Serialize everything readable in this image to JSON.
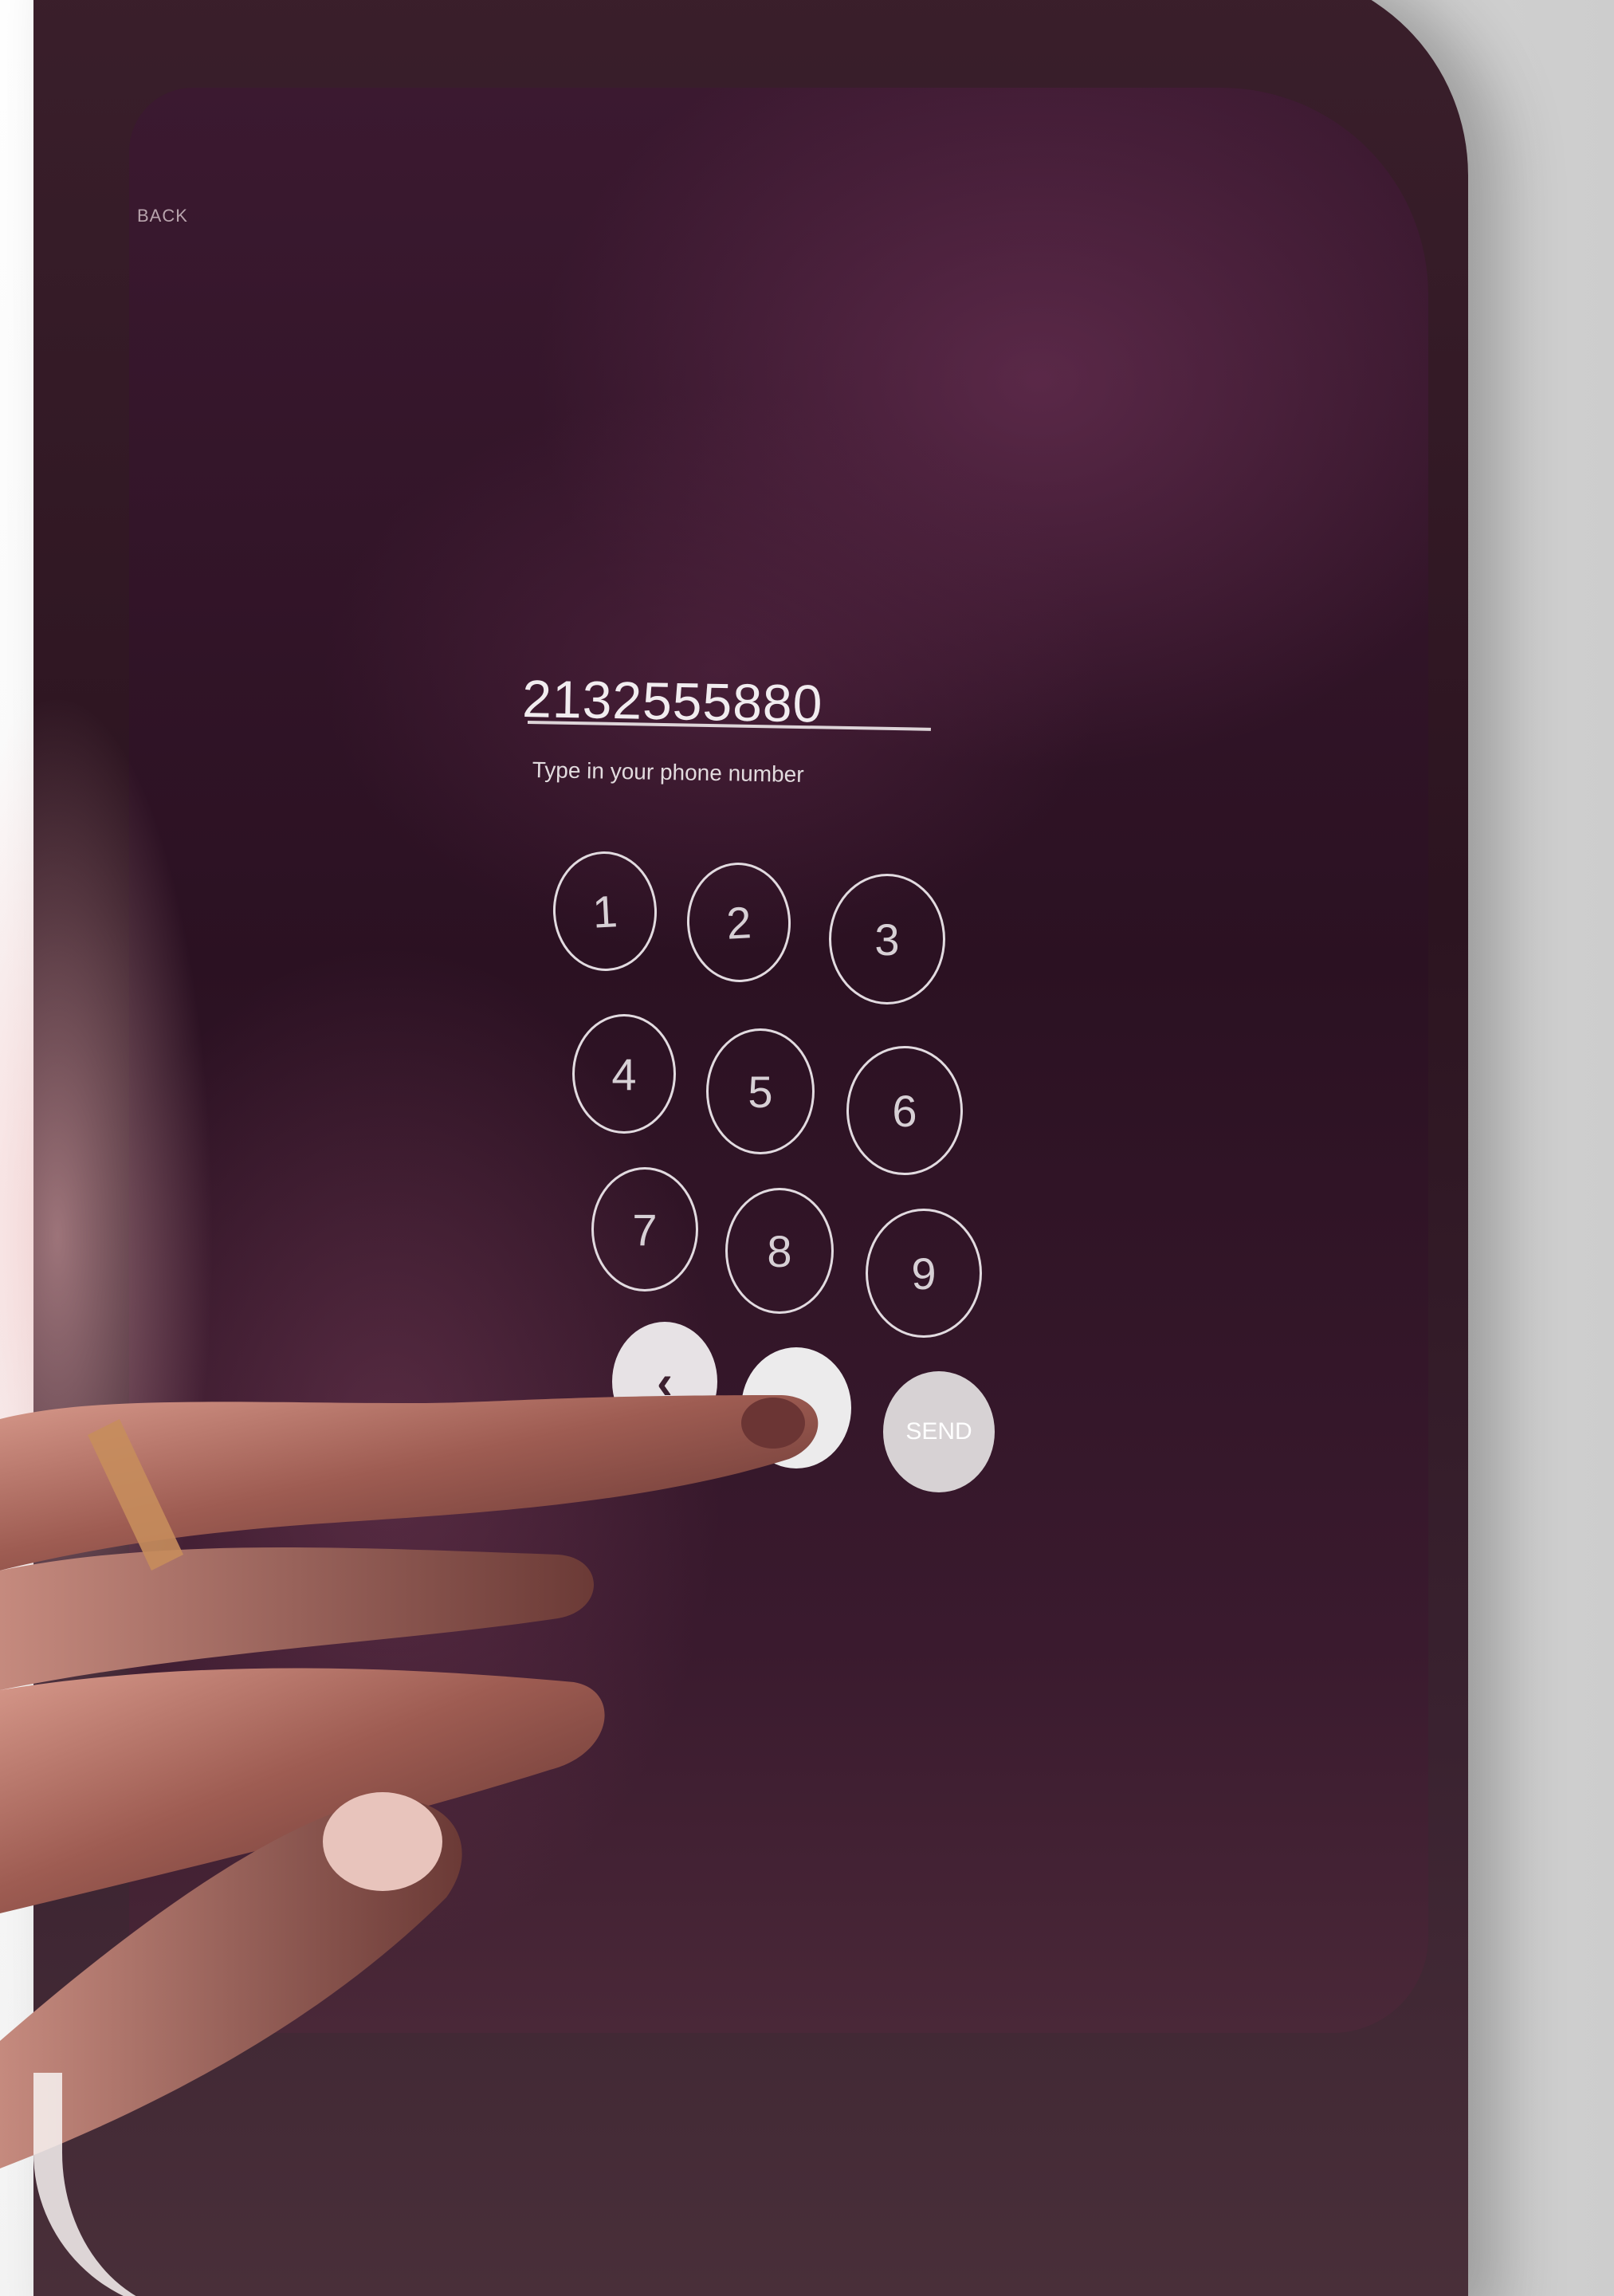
{
  "screen": {
    "back_label": "BACK",
    "phone_number": "2132555880",
    "hint": "Type in your phone number"
  },
  "keypad": {
    "keys": [
      "1",
      "2",
      "3",
      "4",
      "5",
      "6",
      "7",
      "8",
      "9"
    ],
    "back_key": "‹",
    "zero_key": "",
    "send_key": "SEND"
  },
  "icons": {
    "back_arrow": "chevron-left-icon"
  },
  "colors": {
    "screen_bg": "#2b1122",
    "text": "#f1ecef",
    "key_outline": "#e2dbe0"
  }
}
